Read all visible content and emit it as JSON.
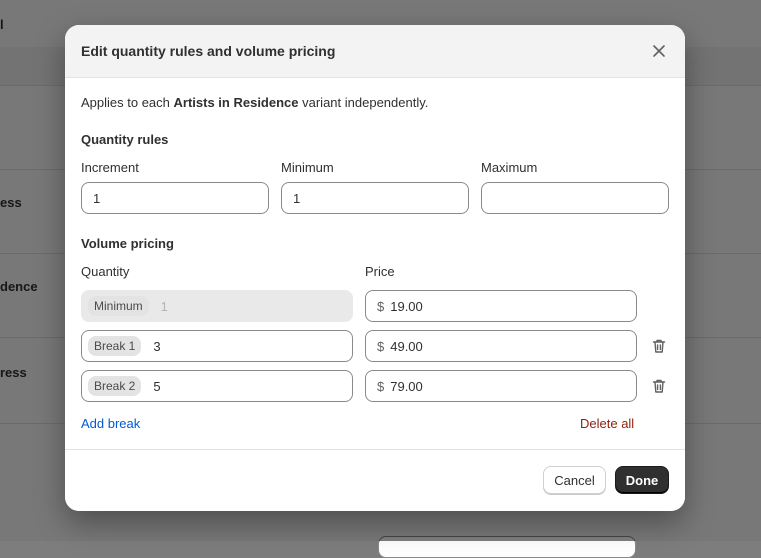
{
  "background": {
    "rows": [
      {
        "label": "l"
      },
      {
        "label": "ess"
      },
      {
        "label": "dence"
      },
      {
        "label": "ress"
      }
    ]
  },
  "modal": {
    "title": "Edit quantity rules and volume pricing",
    "description": {
      "prefix": "Applies to each ",
      "product": "Artists in Residence",
      "suffix": " variant independently."
    },
    "quantity_rules": {
      "title": "Quantity rules",
      "increment_label": "Increment",
      "increment_value": "1",
      "minimum_label": "Minimum",
      "minimum_value": "1",
      "maximum_label": "Maximum",
      "maximum_value": ""
    },
    "volume_pricing": {
      "title": "Volume pricing",
      "quantity_header": "Quantity",
      "price_header": "Price",
      "currency": "$",
      "rows": [
        {
          "chip": "Minimum",
          "quantity": "1",
          "price": "19.00"
        },
        {
          "chip": "Break 1",
          "quantity": "3",
          "price": "49.00"
        },
        {
          "chip": "Break 2",
          "quantity": "5",
          "price": "79.00"
        }
      ],
      "add_break": "Add break",
      "delete_all": "Delete all"
    },
    "footer": {
      "cancel": "Cancel",
      "done": "Done"
    }
  }
}
